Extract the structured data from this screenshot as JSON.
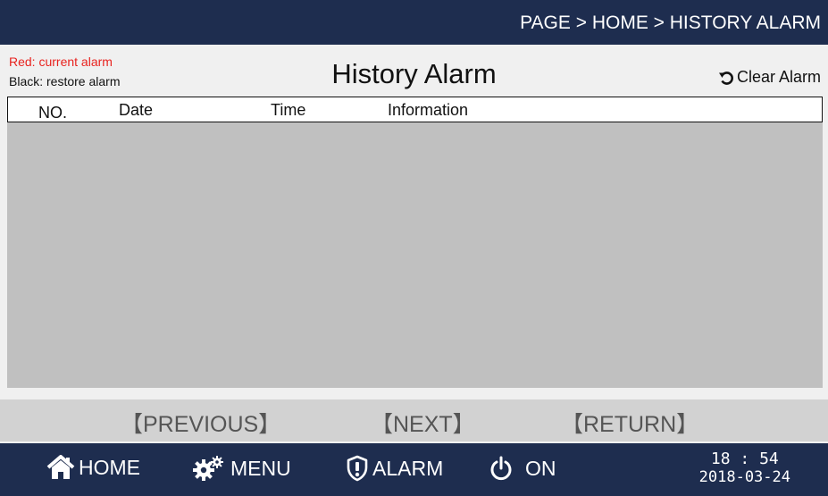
{
  "topbar": {
    "breadcrumb": "PAGE > HOME > HISTORY ALARM"
  },
  "legend": {
    "red": "Red: current alarm",
    "black": "Black: restore alarm"
  },
  "page": {
    "title": "History Alarm",
    "clear_label": "Clear Alarm"
  },
  "table": {
    "columns": [
      "NO.",
      "Date",
      "Time",
      "Information"
    ],
    "rows": []
  },
  "pager": {
    "previous": "【PREVIOUS】",
    "next": "【NEXT】",
    "return": "【RETURN】"
  },
  "nav": {
    "home": "HOME",
    "menu": "MENU",
    "alarm": "ALARM",
    "on": "ON"
  },
  "clock": {
    "time": "18 : 54",
    "date": "2018-03-24"
  },
  "colors": {
    "bar": "#1e2d4f",
    "current_alarm": "#e8231f",
    "table_body": "#c0c0c0",
    "pager": "#d2d2d2"
  },
  "icons": [
    "undo-icon",
    "home-icon",
    "gears-icon",
    "shield-alert-icon",
    "power-icon"
  ]
}
